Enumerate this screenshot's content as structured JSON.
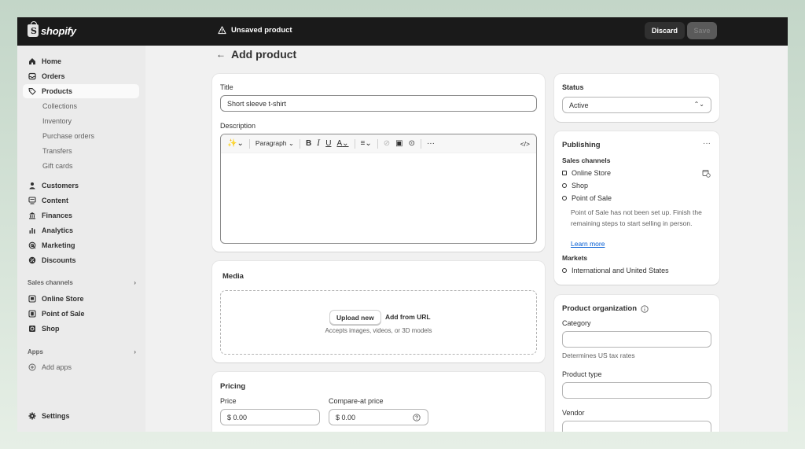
{
  "topbar": {
    "logo_text": "shopify",
    "status_text": "Unsaved product",
    "discard_label": "Discard",
    "save_label": "Save"
  },
  "sidebar": {
    "items": [
      {
        "label": "Home",
        "icon": "home-icon"
      },
      {
        "label": "Orders",
        "icon": "inbox-icon"
      },
      {
        "label": "Products",
        "icon": "tag-icon",
        "active": true
      },
      {
        "label": "Customers",
        "icon": "person-icon"
      },
      {
        "label": "Content",
        "icon": "content-icon"
      },
      {
        "label": "Finances",
        "icon": "bank-icon"
      },
      {
        "label": "Analytics",
        "icon": "bar-chart-icon"
      },
      {
        "label": "Marketing",
        "icon": "target-icon"
      },
      {
        "label": "Discounts",
        "icon": "discount-icon"
      }
    ],
    "product_subitems": [
      "Collections",
      "Inventory",
      "Purchase orders",
      "Transfers",
      "Gift cards"
    ],
    "sales_channels_heading": "Sales channels",
    "sales_channels": [
      {
        "label": "Online Store",
        "icon": "store-icon"
      },
      {
        "label": "Point of Sale",
        "icon": "pos-icon"
      },
      {
        "label": "Shop",
        "icon": "shop-icon"
      }
    ],
    "apps_heading": "Apps",
    "add_apps_label": "Add apps",
    "settings_label": "Settings"
  },
  "main": {
    "back_arrow": "←",
    "page_title": "Add product",
    "title_label": "Title",
    "title_value": "Short sleeve t-shirt",
    "description_label": "Description",
    "editor": {
      "paragraph_label": "Paragraph",
      "bold": "B",
      "italic": "I",
      "underline": "U",
      "color": "A",
      "more": "···",
      "code": "</>"
    },
    "media": {
      "heading": "Media",
      "upload_label": "Upload new",
      "url_label": "Add from URL",
      "accepts_text": "Accepts images, videos, or 3D models"
    },
    "pricing": {
      "heading": "Pricing",
      "price_label": "Price",
      "price_value": "$ 0.00",
      "compare_label": "Compare-at price",
      "compare_value": "$ 0.00"
    }
  },
  "status_card": {
    "heading": "Status",
    "value": "Active"
  },
  "publishing": {
    "heading": "Publishing",
    "menu": "···",
    "sales_channels_label": "Sales channels",
    "channels": [
      "Online Store",
      "Shop",
      "Point of Sale"
    ],
    "pos_note": "Point of Sale has not been set up. Finish the remaining steps to start selling in person.",
    "learn_more": "Learn more",
    "markets_label": "Markets",
    "market": "International and United States"
  },
  "organization": {
    "heading": "Product organization",
    "category_label": "Category",
    "category_hint": "Determines US tax rates",
    "type_label": "Product type",
    "vendor_label": "Vendor"
  },
  "colors": {
    "topbar": "#1a1a1a",
    "sidebar": "#ebebeb",
    "link": "#005bd3"
  }
}
